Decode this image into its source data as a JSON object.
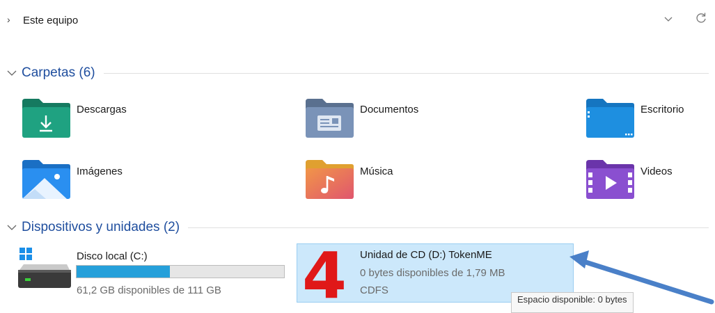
{
  "address_bar": {
    "path": "Este equipo"
  },
  "sections": {
    "folders": {
      "title": "Carpetas (6)",
      "items": [
        {
          "label": "Descargas",
          "icon": "downloads-folder-icon",
          "color": "#1fa281"
        },
        {
          "label": "Documentos",
          "icon": "documents-folder-icon",
          "color": "#7a93b8"
        },
        {
          "label": "Escritorio",
          "icon": "desktop-folder-icon",
          "color": "#1e8fe0"
        },
        {
          "label": "Imágenes",
          "icon": "pictures-folder-icon",
          "color": "#2a8ff0"
        },
        {
          "label": "Música",
          "icon": "music-folder-icon",
          "color": "#ef7656"
        },
        {
          "label": "Videos",
          "icon": "videos-folder-icon",
          "color": "#8a4fd0"
        }
      ]
    },
    "devices": {
      "title": "Dispositivos y unidades (2)",
      "items": [
        {
          "name": "Disco local (C:)",
          "free_text": "61,2 GB disponibles de 111 GB",
          "used_fraction": 0.449,
          "icon": "local-disk-icon"
        },
        {
          "name": "Unidad de CD (D:) TokenME",
          "free_text": "0 bytes disponibles de 1,79 MB",
          "filesystem": "CDFS",
          "icon": "cd-drive-icon",
          "selected": true
        }
      ]
    }
  },
  "tooltip": {
    "text": "Espacio disponible: 0 bytes"
  },
  "annotation": {
    "number": "4",
    "number_color": "#e01818",
    "arrow_color": "#4a80c8"
  }
}
